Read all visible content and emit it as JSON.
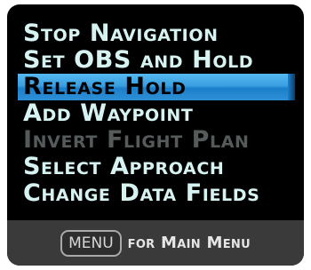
{
  "menu": {
    "items": [
      {
        "label": "Stop Navigation",
        "state": "normal"
      },
      {
        "label": "Set OBS and Hold",
        "state": "normal"
      },
      {
        "label": "Release Hold",
        "state": "selected"
      },
      {
        "label": "Add Waypoint",
        "state": "normal"
      },
      {
        "label": "Invert Flight Plan",
        "state": "disabled"
      },
      {
        "label": "Select Approach",
        "state": "normal"
      },
      {
        "label": "Change Data Fields",
        "state": "normal"
      }
    ]
  },
  "footer": {
    "key_label": "MENU",
    "hint_text": "for Main Menu"
  },
  "colors": {
    "text": "#d6f3f2",
    "disabled": "#555a5a",
    "highlight": "#3a9fe0",
    "background": "#000000",
    "footer_bg": "#3a3a3a"
  }
}
